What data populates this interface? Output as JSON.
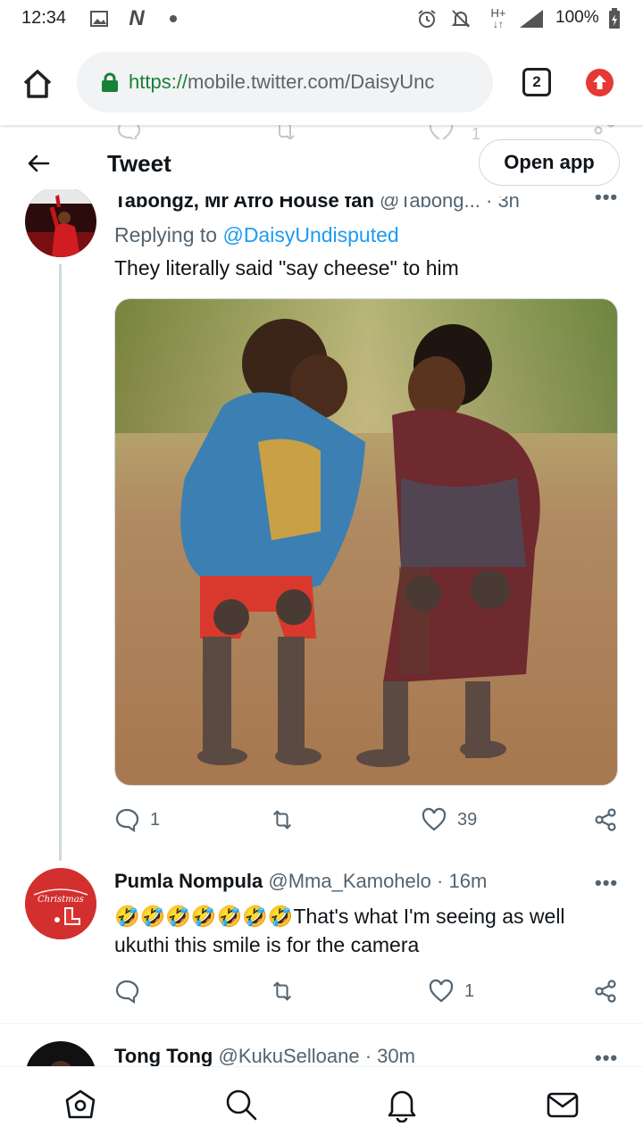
{
  "status_bar": {
    "time": "12:34",
    "network": "H+",
    "battery": "100%"
  },
  "browser": {
    "url_scheme": "https://",
    "url_rest": "mobile.twitter.com/DaisyUnc",
    "tab_count": "2"
  },
  "header": {
    "title": "Tweet",
    "open_app": "Open app"
  },
  "ghost_action": {
    "likes": "1"
  },
  "tweets": [
    {
      "name": "Tabongz, Mr Afro House fan",
      "handle": "@Tabong...",
      "time": "· 3h",
      "replying_prefix": "Replying to ",
      "replying_to": "@DaisyUndisputed",
      "text": "They literally said \"say cheese\" to him",
      "replies": "1",
      "retweets": "",
      "likes": "39"
    },
    {
      "name": "Pumla Nompula",
      "handle": "@Mma_Kamohelo",
      "time": "· 16m",
      "text_line1": "🤣🤣🤣🤣🤣🤣🤣That's what I'm seeing as well",
      "text_line2": "ukuthi this smile is for the camera",
      "replies": "",
      "retweets": "",
      "likes": "1"
    },
    {
      "name": "Tong Tong",
      "handle": "@KukuSelloane",
      "time": "· 30m"
    }
  ],
  "colors": {
    "accent": "#1d9bf0",
    "text": "#0f1419",
    "muted": "#536471",
    "border": "#cfd9de",
    "lock": "#188038",
    "update": "#e53935"
  },
  "icons": [
    "home-icon",
    "lock-icon",
    "tabs-icon",
    "update-icon",
    "back-arrow-icon",
    "reply-icon",
    "retweet-icon",
    "like-icon",
    "share-icon",
    "nav-home-icon",
    "nav-search-icon",
    "nav-notifications-icon",
    "nav-messages-icon"
  ]
}
